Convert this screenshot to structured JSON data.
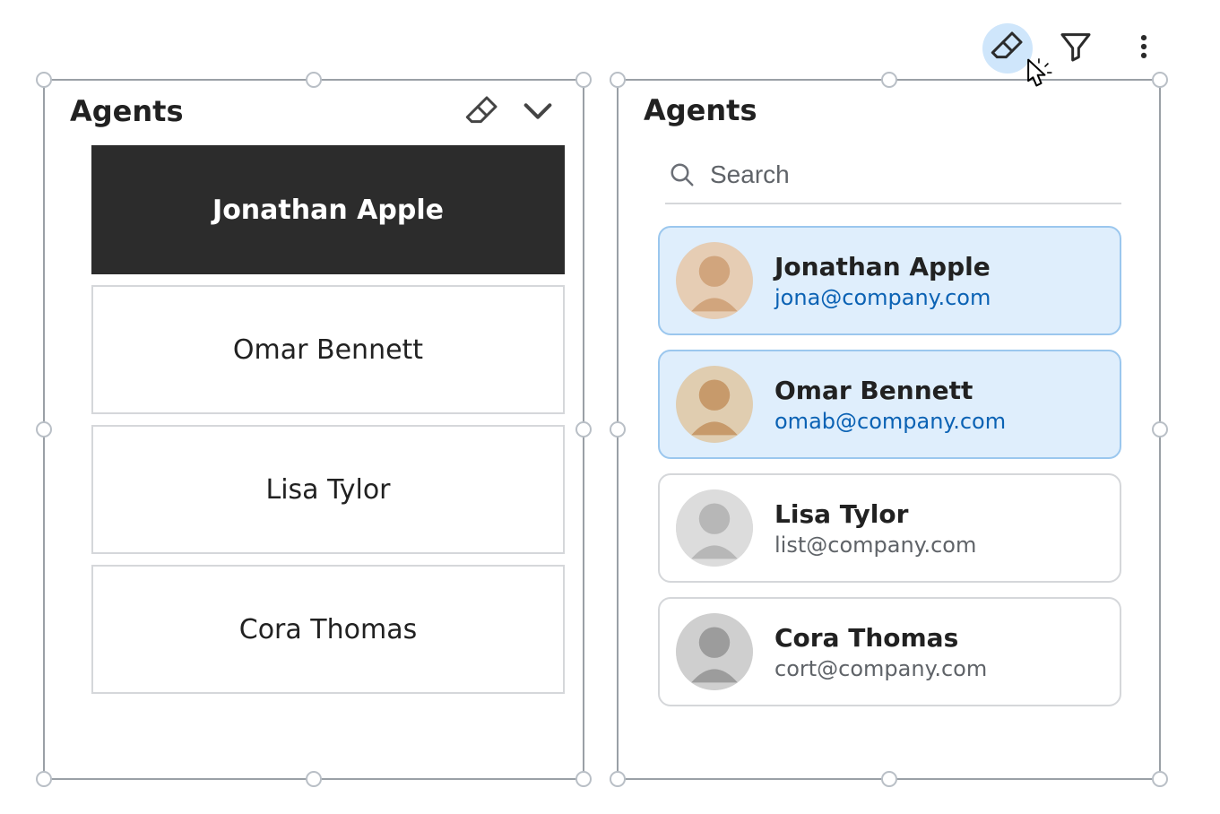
{
  "left_panel": {
    "title": "Agents",
    "items": [
      {
        "name": "Jonathan Apple",
        "selected": true
      },
      {
        "name": "Omar Bennett",
        "selected": false
      },
      {
        "name": "Lisa Tylor",
        "selected": false
      },
      {
        "name": "Cora Thomas",
        "selected": false
      }
    ],
    "icons": {
      "eraser": "eraser-icon",
      "chevron": "chevron-down-icon"
    }
  },
  "right_panel": {
    "title": "Agents",
    "search_placeholder": "Search",
    "items": [
      {
        "name": "Jonathan Apple",
        "email": "jona@company.com",
        "selected": true
      },
      {
        "name": "Omar Bennett",
        "email": "omab@company.com",
        "selected": true
      },
      {
        "name": "Lisa Tylor",
        "email": "list@company.com",
        "selected": false
      },
      {
        "name": "Cora Thomas",
        "email": "cort@company.com",
        "selected": false
      }
    ]
  },
  "toolbar": {
    "eraser_active": true,
    "icons": {
      "eraser": "eraser-icon",
      "filter": "filter-icon",
      "more": "more-vertical-icon"
    }
  }
}
